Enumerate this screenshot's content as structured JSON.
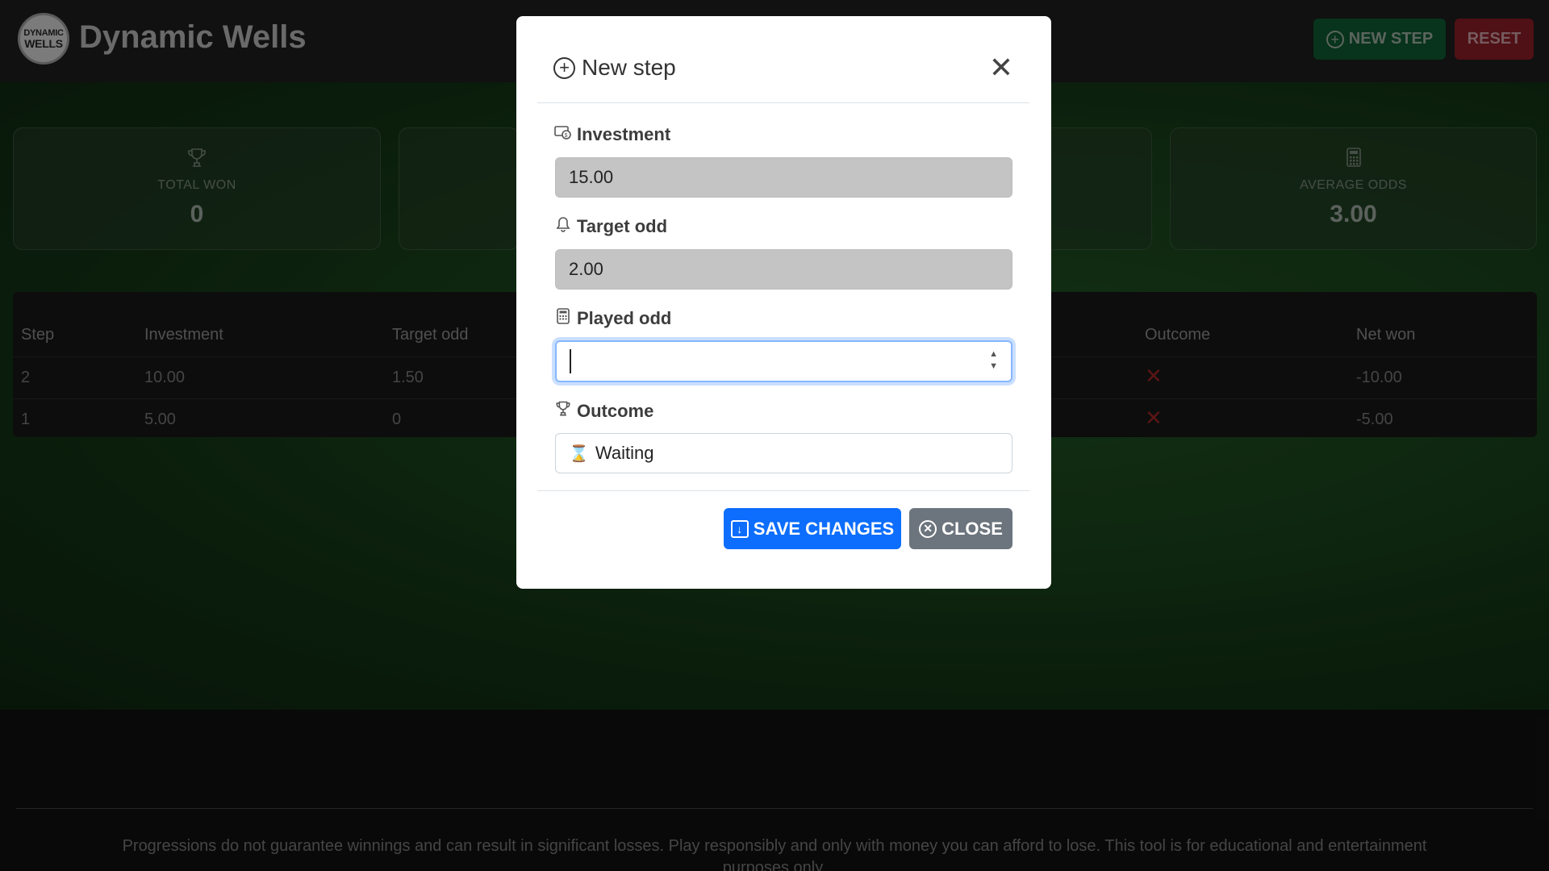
{
  "header": {
    "logo_line1": "DYNAMIC",
    "logo_line2": "WELLS",
    "brand": "Dynamic Wells",
    "new_step_label": "NEW STEP",
    "reset_label": "RESET"
  },
  "stats": [
    {
      "icon": "trophy-icon",
      "label": "TOTAL WON",
      "value": "0"
    },
    {
      "icon": "calculator-icon",
      "label": "AVERAGE ODDS",
      "value": "3.00"
    }
  ],
  "table": {
    "columns": [
      "Step",
      "Investment",
      "Target odd",
      "Outcome",
      "Net won"
    ],
    "rows": [
      {
        "step": "2",
        "investment": "10.00",
        "target_odd": "1.50",
        "outcome": "✕",
        "net_won": "-10.00"
      },
      {
        "step": "1",
        "investment": "5.00",
        "target_odd": "0",
        "outcome": "✕",
        "net_won": "-5.00"
      }
    ]
  },
  "disclaimer": "Progressions do not guarantee winnings and can result in significant losses. Play responsibly and only with money you can afford to lose. This tool is for educational and entertainment purposes only.",
  "modal": {
    "title": "New step",
    "investment_label": "Investment",
    "investment_value": "15.00",
    "target_odd_label": "Target odd",
    "target_odd_value": "2.00",
    "played_odd_label": "Played odd",
    "played_odd_value": "",
    "outcome_label": "Outcome",
    "outcome_value": "Waiting",
    "save_label": "SAVE CHANGES",
    "close_label": "CLOSE"
  },
  "colors": {
    "primary": "#0d6efd",
    "secondary": "#6c757d",
    "success_dark": "#0d4f2c",
    "danger_dark": "#7a1a22"
  }
}
